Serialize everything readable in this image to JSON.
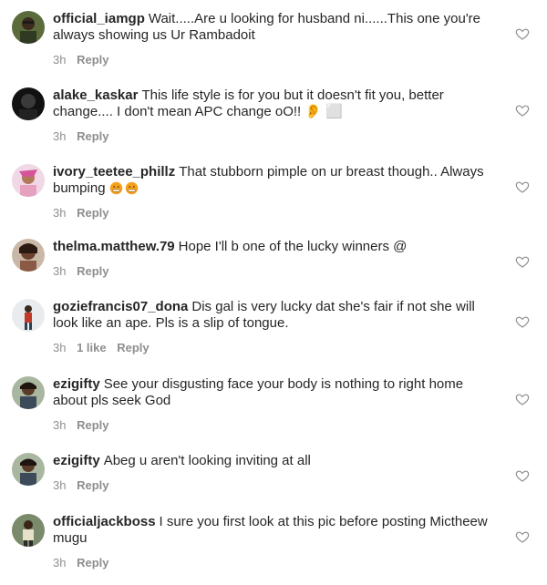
{
  "colors": {
    "text": "#262626",
    "meta": "#8e8e8e",
    "background": "#ffffff",
    "heart_outline": "#8e8e8e",
    "emoji_orange": "#f4a21d"
  },
  "comments": [
    {
      "username": "official_iamgp",
      "text": "Wait.....Are u looking for husband ni......This one you're always showing us Ur Rambadoit",
      "time": "3h",
      "likes": "",
      "reply": "Reply",
      "avatar_icon": "avatar-photo-icon"
    },
    {
      "username": "alake_kaskar",
      "text": "This life style is for you but it doesn't fit you, better change.... I don't mean APC change oO!!",
      "suffix": "👂 ⬜",
      "time": "3h",
      "likes": "",
      "reply": "Reply",
      "avatar_icon": "avatar-photo-icon"
    },
    {
      "username": "ivory_teetee_phillz",
      "text": "That stubborn pimple on ur breast though.. Always bumping",
      "time": "3h",
      "likes": "",
      "reply": "Reply",
      "avatar_icon": "avatar-photo-icon",
      "emojis": [
        "grimace-face-emoji",
        "grimace-face-emoji"
      ]
    },
    {
      "username": "thelma.matthew.79",
      "text": "Hope I'll b one of the lucky winners @",
      "time": "3h",
      "likes": "",
      "reply": "Reply",
      "avatar_icon": "avatar-photo-icon"
    },
    {
      "username": "goziefrancis07_dona",
      "text": "Dis gal is very lucky dat she's fair if not she will look like an ape. Pls is a slip of tongue.",
      "time": "3h",
      "likes": "1 like",
      "reply": "Reply",
      "avatar_icon": "avatar-photo-icon"
    },
    {
      "username": "ezigifty",
      "text": "See your disgusting face your body is  nothing to right home about pls seek God",
      "time": "3h",
      "likes": "",
      "reply": "Reply",
      "avatar_icon": "avatar-photo-icon"
    },
    {
      "username": "ezigifty",
      "text": "Abeg u aren't looking inviting at all",
      "time": "3h",
      "likes": "",
      "reply": "Reply",
      "avatar_icon": "avatar-photo-icon"
    },
    {
      "username": "officialjackboss",
      "text": "I sure you first look at this pic before posting Mictheew mugu",
      "time": "3h",
      "likes": "",
      "reply": "Reply",
      "avatar_icon": "avatar-photo-icon"
    }
  ]
}
